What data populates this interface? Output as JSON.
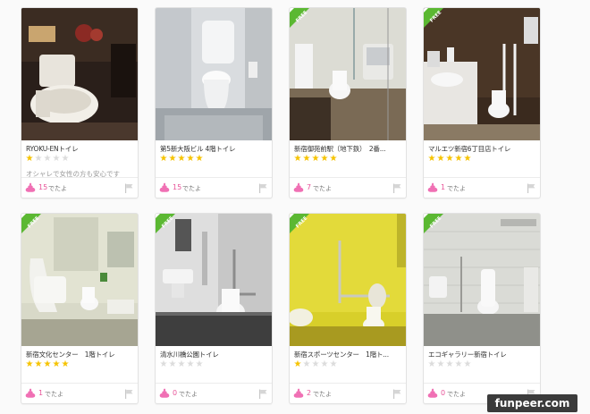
{
  "toilets": [
    {
      "title": "RYOKU-ENトイレ",
      "rating": 1,
      "description": "オシャレで女性の方も安心です",
      "count": "15",
      "unit": "でたよ",
      "free": false
    },
    {
      "title": "第5新大阪ビル 4階トイレ",
      "rating": 5,
      "description": "",
      "count": "15",
      "unit": "でたよ",
      "free": false
    },
    {
      "title": "新宿御苑前駅（地下鉄）　2番...",
      "rating": 5,
      "description": "",
      "count": "7",
      "unit": "でたよ",
      "free": true
    },
    {
      "title": "マルエツ新宿6丁目店トイレ",
      "rating": 5,
      "description": "",
      "count": "1",
      "unit": "でたよ",
      "free": true
    },
    {
      "title": "新宿文化センター　1階トイレ",
      "rating": 5,
      "description": "",
      "count": "1",
      "unit": "でたよ",
      "free": true
    },
    {
      "title": "清水川橋公園トイレ",
      "rating": 0,
      "description": "",
      "count": "0",
      "unit": "でたよ",
      "free": true
    },
    {
      "title": "新宿スポーツセンター　1階ト...",
      "rating": 1,
      "description": "",
      "count": "2",
      "unit": "でたよ",
      "free": true
    },
    {
      "title": "エコギャラリー新宿トイレ",
      "rating": 0,
      "description": "",
      "count": "0",
      "unit": "でたよ",
      "free": true
    }
  ],
  "free_badge_label": "FREE",
  "watermark": "funpeer.com",
  "colors": {
    "count_pink": "#e8559a",
    "star_gold": "#f6c300",
    "free_green": "#5bb832"
  }
}
